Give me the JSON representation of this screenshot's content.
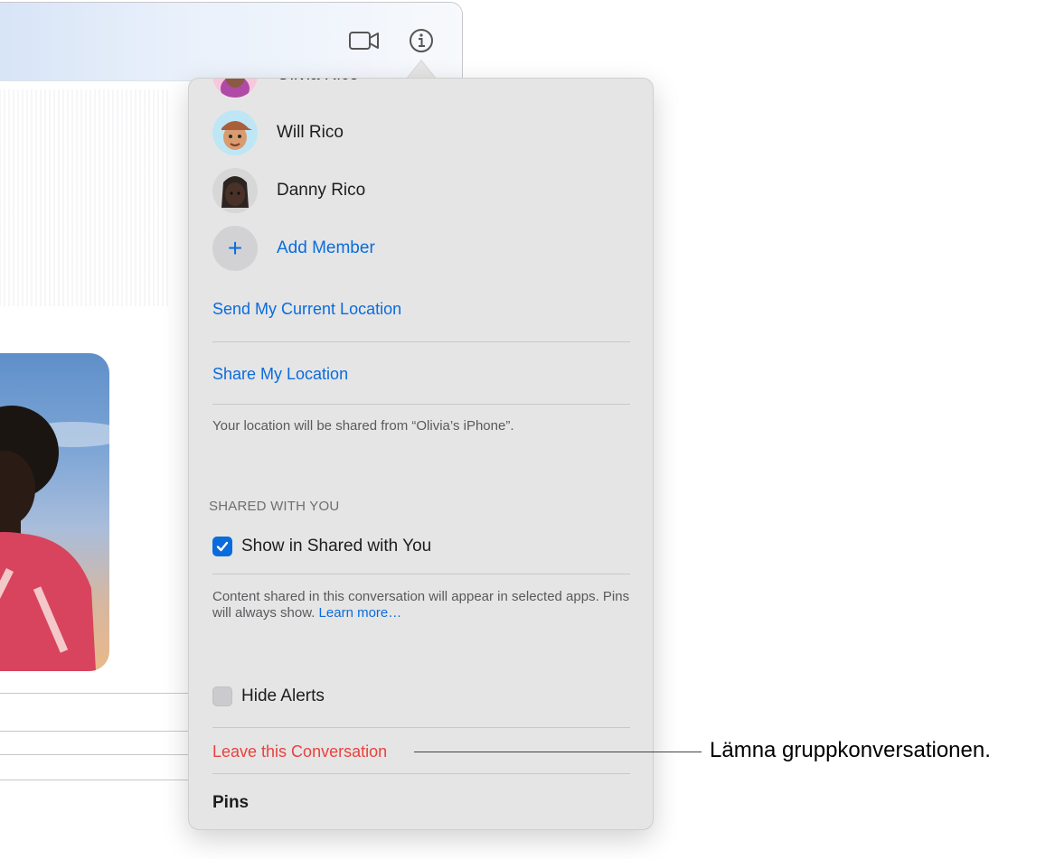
{
  "toolbar": {
    "video_icon": "video-camera-icon",
    "info_icon": "info-icon"
  },
  "members": [
    {
      "name": "Olivia Rico",
      "avatar": "memoji-olivia"
    },
    {
      "name": "Will Rico",
      "avatar": "memoji-will"
    },
    {
      "name": "Danny Rico",
      "avatar": "memoji-danny"
    }
  ],
  "add_member": {
    "label": "Add Member",
    "icon": "plus-icon"
  },
  "location": {
    "send_current": "Send My Current Location",
    "share": "Share My Location",
    "note": "Your location will be shared from “Olivia’s iPhone”."
  },
  "shared_with_you": {
    "header": "SHARED WITH YOU",
    "show_label": "Show in Shared with You",
    "show_checked": true,
    "note": "Content shared in this conversation will appear in selected apps. Pins will always show.",
    "learn_more": "Learn more…"
  },
  "alerts": {
    "hide_label": "Hide Alerts",
    "hide_checked": false
  },
  "leave_label": "Leave this Conversation",
  "pins_label": "Pins",
  "callout": "Lämna gruppkonversationen.",
  "colors": {
    "accent": "#0a6cdc",
    "destructive": "#e8423d",
    "popover_bg": "#e5e5e5"
  }
}
